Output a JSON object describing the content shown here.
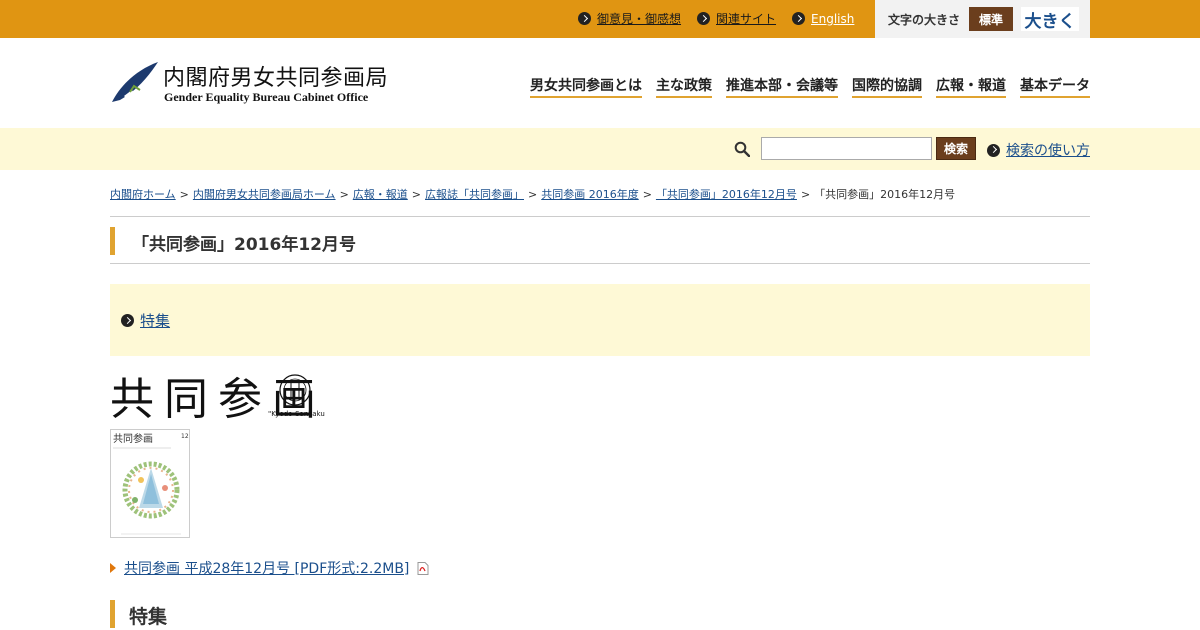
{
  "topbar": {
    "links": [
      {
        "label": "御意見・御感想"
      },
      {
        "label": "関連サイト"
      },
      {
        "label": "English"
      }
    ],
    "fontsize": {
      "label": "文字の大きさ",
      "standard": "標準",
      "large": "大きく"
    }
  },
  "logo": {
    "ja": "内閣府男女共同参画局",
    "en": "Gender Equality Bureau Cabinet Office"
  },
  "gnav": [
    {
      "label": "男女共同参画とは"
    },
    {
      "label": "主な政策"
    },
    {
      "label": "推進本部・会議等"
    },
    {
      "label": "国際的協調"
    },
    {
      "label": "広報・報道"
    },
    {
      "label": "基本データ"
    }
  ],
  "search": {
    "value": "",
    "button": "検索",
    "help": "検索の使い方"
  },
  "breadcrumb": {
    "items": [
      "内閣府ホーム",
      "内閣府男女共同参画局ホーム",
      "広報・報道",
      "広報誌「共同参画」",
      "共同参画 2016年度",
      "「共同参画」2016年12月号"
    ],
    "current": "「共同参画」2016年12月号",
    "sep_first": ">",
    "sep": ">"
  },
  "page": {
    "title": "「共同参画」2016年12月号",
    "toc": [
      {
        "label": "特集"
      }
    ],
    "masthead": {
      "title": "共同参画",
      "sub": "\"Kyodo-Sankaku\""
    },
    "cover": {
      "title": "共同参画",
      "issue": "12"
    },
    "pdf_link": "共同参画 平成28年12月号 [PDF形式:2.2MB]",
    "section_heading": "特集"
  },
  "colors": {
    "topbar": "#e09512",
    "accent": "#e0a330",
    "brown": "#6b3e1d",
    "cream": "#fef9d6",
    "link": "#1b4f8c"
  }
}
